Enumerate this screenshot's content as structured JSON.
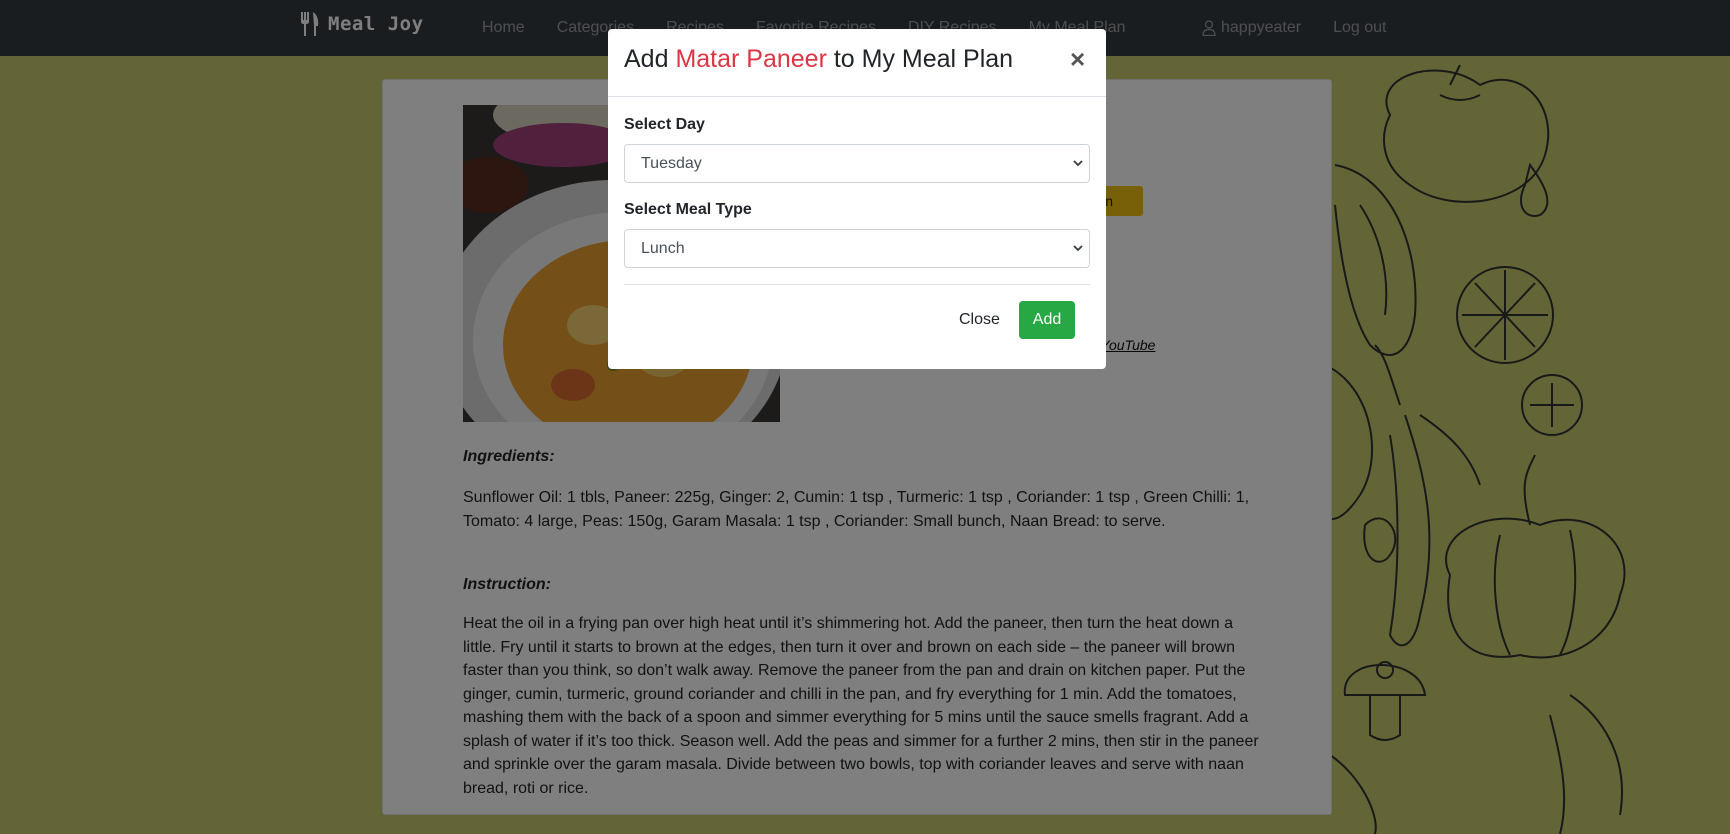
{
  "navbar": {
    "brand": "Meal Joy",
    "brand_icon": "fork-knife-icon",
    "links": [
      "Home",
      "Categories",
      "Recipes",
      "Favorite Recipes",
      "DIY Recipes",
      "My Meal Plan"
    ],
    "username": "happyeater",
    "user_icon": "person-icon",
    "logout": "Log out"
  },
  "recipe": {
    "meal_plan_button_fragment": "Plan",
    "youtube_fragment": "n YouTube",
    "ingredients_heading": "Ingredients:",
    "ingredients": "Sunflower Oil: 1 tbls, Paneer: 225g, Ginger: 2, Cumin: 1 tsp , Turmeric: 1 tsp , Coriander: 1 tsp , Green Chilli: 1, Tomato: 4 large, Peas: 150g, Garam Masala: 1 tsp , Coriander: Small bunch, Naan Bread: to serve.",
    "instruction_heading": "Instruction:",
    "instruction": "Heat the oil in a frying pan over high heat until it’s shimmering hot. Add the paneer, then turn the heat down a little. Fry until it starts to brown at the edges, then turn it over and brown on each side – the paneer will brown faster than you think, so don’t walk away. Remove the paneer from the pan and drain on kitchen paper. Put the ginger, cumin, turmeric, ground coriander and chilli in the pan, and fry everything for 1 min. Add the tomatoes, mashing them with the back of a spoon and simmer everything for 5 mins until the sauce smells fragrant. Add a splash of water if it’s too thick. Season well. Add the peas and simmer for a further 2 mins, then stir in the paneer and sprinkle over the garam masala. Divide between two bowls, top with coriander leaves and serve with naan bread, roti or rice."
  },
  "modal": {
    "title_prefix": "Add ",
    "title_highlight": "Matar Paneer",
    "title_suffix": " to My Meal Plan",
    "close_symbol": "×",
    "day_label": "Select Day",
    "day_value": "Tuesday",
    "meal_type_label": "Select Meal Type",
    "meal_type_value": "Lunch",
    "close_button": "Close",
    "add_button": "Add"
  },
  "colors": {
    "page_background": "#c8ca6c",
    "navbar": "#343a40",
    "highlight": "#dc3545",
    "add_button": "#28a745",
    "meal_plan_button": "#f0c010"
  }
}
